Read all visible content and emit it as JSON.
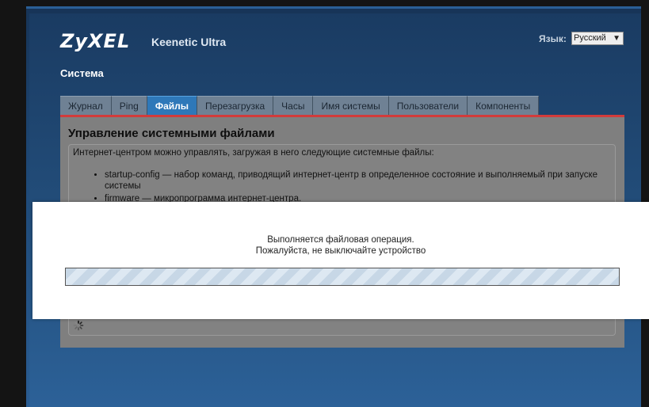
{
  "brand": {
    "logo": "ZyXEL",
    "model": "Keenetic Ultra"
  },
  "language": {
    "label": "Язык:",
    "selected": "Русский"
  },
  "section_title": "Система",
  "tabs": [
    {
      "label": "Журнал"
    },
    {
      "label": "Ping"
    },
    {
      "label": "Файлы",
      "active": true
    },
    {
      "label": "Перезагрузка"
    },
    {
      "label": "Часы"
    },
    {
      "label": "Имя системы"
    },
    {
      "label": "Пользователи"
    },
    {
      "label": "Компоненты"
    }
  ],
  "panel": {
    "heading": "Управление системными файлами",
    "intro": "Интернет-центром можно управлять, загружая в него следующие системные файлы:",
    "items": [
      "startup-config — набор команд, приводящий интернет-центр в определенное состояние и выполняемый при запуске системы",
      "firmware — микропрограмма интернет-центра."
    ]
  },
  "modal": {
    "line1": "Выполняется файловая операция.",
    "line2": "Пожалуйста, не выключайте устройство",
    "progress": 1.0
  },
  "colors": {
    "accent_tab": "#2e78b9",
    "red_line": "#d23b3b",
    "frame_bg": "#1f4a78"
  },
  "icons": {
    "spinner": "loading-spinner-icon",
    "select_chevron": "chevron-down-icon"
  }
}
